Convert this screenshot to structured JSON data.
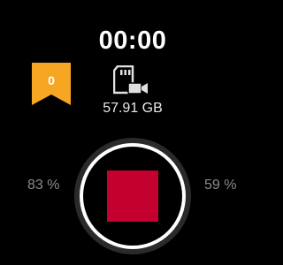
{
  "recorder": {
    "timer": "00:00",
    "bookmark_count": "0",
    "storage_free": "57.91 GB",
    "left_percent": "83 %",
    "right_percent": "59 %"
  },
  "icons": {
    "bookmark": "bookmark-icon",
    "storage": "sdcard-video-icon",
    "stop": "stop-icon"
  },
  "colors": {
    "bookmark": "#f6a623",
    "stop": "#c4002f",
    "ring": "#ffffff",
    "outer_ring": "#2a2a2a",
    "percent_text": "#8a8a8a"
  }
}
